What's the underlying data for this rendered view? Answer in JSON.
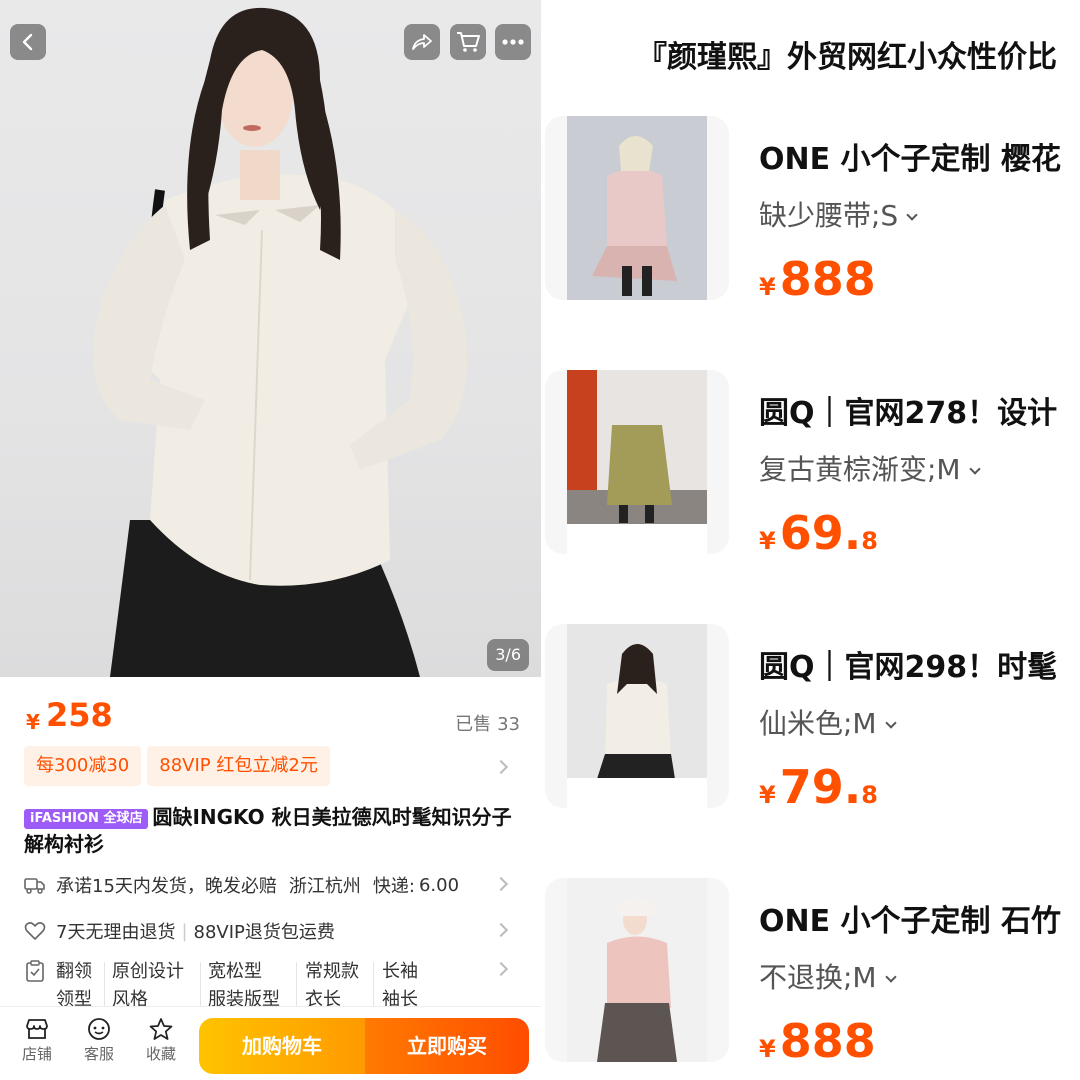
{
  "left": {
    "image_counter": "3/6",
    "price": {
      "currency": "¥",
      "value": "258"
    },
    "sold": {
      "label": "已售",
      "count": "33"
    },
    "promos": [
      "每300减30",
      "88VIP 红包立减2元"
    ],
    "title": {
      "badge": "iFASHION 全球店",
      "text": "圆缺INGKO 秋日美拉德风时髦知识分子解构衬衫"
    },
    "shipping": {
      "promise": "承诺15天内发货，晚发必赔",
      "location": "浙江杭州",
      "express_label": "快递:",
      "express_fee": "6.00"
    },
    "returns": {
      "policy": "7天无理由退货",
      "vip": "88VIP退货包运费"
    },
    "attributes": [
      {
        "top": "翻领",
        "bottom": "领型"
      },
      {
        "top": "原创设计",
        "bottom": "风格"
      },
      {
        "top": "宽松型",
        "bottom": "服装版型"
      },
      {
        "top": "常规款",
        "bottom": "衣长"
      },
      {
        "top": "长袖",
        "bottom": "袖长"
      }
    ],
    "bottom_bar": {
      "store": "店铺",
      "service": "客服",
      "favorite": "收藏",
      "add_to_cart": "加购物车",
      "buy_now": "立即购买"
    },
    "icons": [
      "back-icon",
      "share-icon",
      "cart-icon",
      "more-icon",
      "truck-icon",
      "heart-icon",
      "clipboard-icon",
      "store-icon",
      "service-icon",
      "star-icon"
    ],
    "accent_color": "#ff5000"
  },
  "right": {
    "shop_title": "『颜瑾熙』外贸网红小众性价比",
    "items": [
      {
        "title": "ONE  小个子定制 樱花",
        "sku": "缺少腰带;S",
        "price_currency": "¥",
        "price_int": "888",
        "price_dec": ""
      },
      {
        "title": "圆Q｜官网278！设计",
        "sku": "复古黄棕渐变;M",
        "price_currency": "¥",
        "price_int": "69.",
        "price_dec": "8"
      },
      {
        "title": "圆Q｜官网298！时髦",
        "sku": "仙米色;M",
        "price_currency": "¥",
        "price_int": "79.",
        "price_dec": "8"
      },
      {
        "title": "ONE 小个子定制 石竹",
        "sku": "不退换;M",
        "price_currency": "¥",
        "price_int": "888",
        "price_dec": ""
      }
    ]
  }
}
